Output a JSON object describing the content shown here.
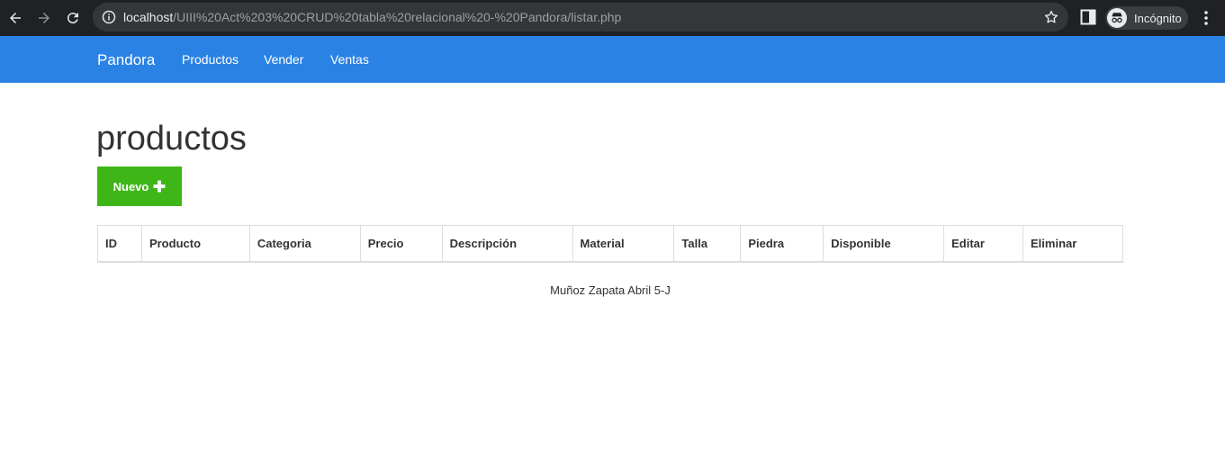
{
  "browser": {
    "url_host": "localhost",
    "url_path": "/UIII%20Act%203%20CRUD%20tabla%20relacional%20-%20Pandora/listar.php",
    "profile_label": "Incógnito",
    "icons": [
      "back-arrow-icon",
      "forward-arrow-icon",
      "reload-icon",
      "info-icon",
      "star-icon",
      "side-panel-icon",
      "incognito-icon",
      "more-vert-icon"
    ]
  },
  "navbar": {
    "brand": "Pandora",
    "links": [
      {
        "label": "Productos"
      },
      {
        "label": "Vender"
      },
      {
        "label": "Ventas"
      }
    ],
    "color": "#2a82e4"
  },
  "main": {
    "title": "productos",
    "new_button": {
      "label": "Nuevo",
      "icon": "plus-icon",
      "color": "#3fb618"
    },
    "table": {
      "headers": [
        "ID",
        "Producto",
        "Categoria",
        "Precio",
        "Descripción",
        "Material",
        "Talla",
        "Piedra",
        "Disponible",
        "Editar",
        "Eliminar"
      ],
      "rows": []
    }
  },
  "footer": {
    "text": "Muñoz Zapata Abril 5-J"
  }
}
